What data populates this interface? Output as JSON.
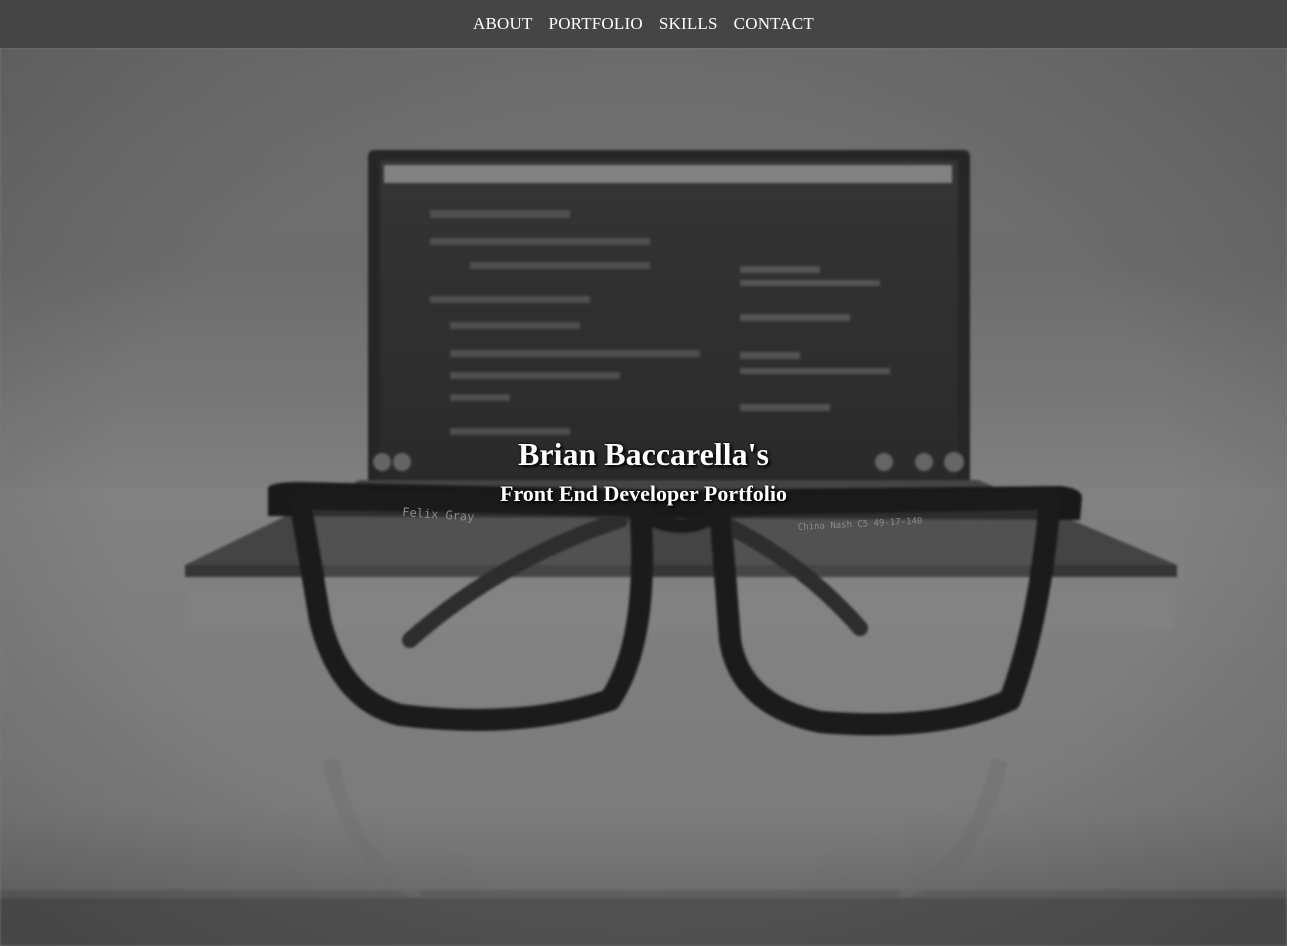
{
  "nav": {
    "items": [
      {
        "label": "ABOUT"
      },
      {
        "label": "PORTFOLIO"
      },
      {
        "label": "SKILLS"
      },
      {
        "label": "CONTACT"
      }
    ]
  },
  "hero": {
    "title": "Brian Baccarella's",
    "subtitle": "Front End Developer Portfolio",
    "background_image": "photo of eyeglasses in front of a laptop showing code, grayscale",
    "glasses_frame_text": "Felix Gray",
    "glasses_arm_text": "China   Nash C5 49-17-140"
  },
  "colors": {
    "navbar_bg": "#454545",
    "nav_text": "#ffffff",
    "hero_text": "#ffffff"
  }
}
